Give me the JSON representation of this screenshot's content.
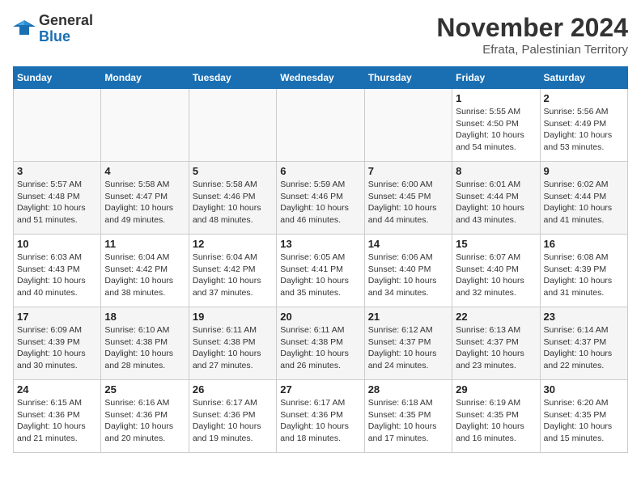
{
  "logo": {
    "text_general": "General",
    "text_blue": "Blue"
  },
  "header": {
    "month": "November 2024",
    "location": "Efrata, Palestinian Territory"
  },
  "weekdays": [
    "Sunday",
    "Monday",
    "Tuesday",
    "Wednesday",
    "Thursday",
    "Friday",
    "Saturday"
  ],
  "weeks": [
    [
      {
        "day": "",
        "info": ""
      },
      {
        "day": "",
        "info": ""
      },
      {
        "day": "",
        "info": ""
      },
      {
        "day": "",
        "info": ""
      },
      {
        "day": "",
        "info": ""
      },
      {
        "day": "1",
        "sunrise": "Sunrise: 5:55 AM",
        "sunset": "Sunset: 4:50 PM",
        "daylight": "Daylight: 10 hours and 54 minutes."
      },
      {
        "day": "2",
        "sunrise": "Sunrise: 5:56 AM",
        "sunset": "Sunset: 4:49 PM",
        "daylight": "Daylight: 10 hours and 53 minutes."
      }
    ],
    [
      {
        "day": "3",
        "sunrise": "Sunrise: 5:57 AM",
        "sunset": "Sunset: 4:48 PM",
        "daylight": "Daylight: 10 hours and 51 minutes."
      },
      {
        "day": "4",
        "sunrise": "Sunrise: 5:58 AM",
        "sunset": "Sunset: 4:47 PM",
        "daylight": "Daylight: 10 hours and 49 minutes."
      },
      {
        "day": "5",
        "sunrise": "Sunrise: 5:58 AM",
        "sunset": "Sunset: 4:46 PM",
        "daylight": "Daylight: 10 hours and 48 minutes."
      },
      {
        "day": "6",
        "sunrise": "Sunrise: 5:59 AM",
        "sunset": "Sunset: 4:46 PM",
        "daylight": "Daylight: 10 hours and 46 minutes."
      },
      {
        "day": "7",
        "sunrise": "Sunrise: 6:00 AM",
        "sunset": "Sunset: 4:45 PM",
        "daylight": "Daylight: 10 hours and 44 minutes."
      },
      {
        "day": "8",
        "sunrise": "Sunrise: 6:01 AM",
        "sunset": "Sunset: 4:44 PM",
        "daylight": "Daylight: 10 hours and 43 minutes."
      },
      {
        "day": "9",
        "sunrise": "Sunrise: 6:02 AM",
        "sunset": "Sunset: 4:44 PM",
        "daylight": "Daylight: 10 hours and 41 minutes."
      }
    ],
    [
      {
        "day": "10",
        "sunrise": "Sunrise: 6:03 AM",
        "sunset": "Sunset: 4:43 PM",
        "daylight": "Daylight: 10 hours and 40 minutes."
      },
      {
        "day": "11",
        "sunrise": "Sunrise: 6:04 AM",
        "sunset": "Sunset: 4:42 PM",
        "daylight": "Daylight: 10 hours and 38 minutes."
      },
      {
        "day": "12",
        "sunrise": "Sunrise: 6:04 AM",
        "sunset": "Sunset: 4:42 PM",
        "daylight": "Daylight: 10 hours and 37 minutes."
      },
      {
        "day": "13",
        "sunrise": "Sunrise: 6:05 AM",
        "sunset": "Sunset: 4:41 PM",
        "daylight": "Daylight: 10 hours and 35 minutes."
      },
      {
        "day": "14",
        "sunrise": "Sunrise: 6:06 AM",
        "sunset": "Sunset: 4:40 PM",
        "daylight": "Daylight: 10 hours and 34 minutes."
      },
      {
        "day": "15",
        "sunrise": "Sunrise: 6:07 AM",
        "sunset": "Sunset: 4:40 PM",
        "daylight": "Daylight: 10 hours and 32 minutes."
      },
      {
        "day": "16",
        "sunrise": "Sunrise: 6:08 AM",
        "sunset": "Sunset: 4:39 PM",
        "daylight": "Daylight: 10 hours and 31 minutes."
      }
    ],
    [
      {
        "day": "17",
        "sunrise": "Sunrise: 6:09 AM",
        "sunset": "Sunset: 4:39 PM",
        "daylight": "Daylight: 10 hours and 30 minutes."
      },
      {
        "day": "18",
        "sunrise": "Sunrise: 6:10 AM",
        "sunset": "Sunset: 4:38 PM",
        "daylight": "Daylight: 10 hours and 28 minutes."
      },
      {
        "day": "19",
        "sunrise": "Sunrise: 6:11 AM",
        "sunset": "Sunset: 4:38 PM",
        "daylight": "Daylight: 10 hours and 27 minutes."
      },
      {
        "day": "20",
        "sunrise": "Sunrise: 6:11 AM",
        "sunset": "Sunset: 4:38 PM",
        "daylight": "Daylight: 10 hours and 26 minutes."
      },
      {
        "day": "21",
        "sunrise": "Sunrise: 6:12 AM",
        "sunset": "Sunset: 4:37 PM",
        "daylight": "Daylight: 10 hours and 24 minutes."
      },
      {
        "day": "22",
        "sunrise": "Sunrise: 6:13 AM",
        "sunset": "Sunset: 4:37 PM",
        "daylight": "Daylight: 10 hours and 23 minutes."
      },
      {
        "day": "23",
        "sunrise": "Sunrise: 6:14 AM",
        "sunset": "Sunset: 4:37 PM",
        "daylight": "Daylight: 10 hours and 22 minutes."
      }
    ],
    [
      {
        "day": "24",
        "sunrise": "Sunrise: 6:15 AM",
        "sunset": "Sunset: 4:36 PM",
        "daylight": "Daylight: 10 hours and 21 minutes."
      },
      {
        "day": "25",
        "sunrise": "Sunrise: 6:16 AM",
        "sunset": "Sunset: 4:36 PM",
        "daylight": "Daylight: 10 hours and 20 minutes."
      },
      {
        "day": "26",
        "sunrise": "Sunrise: 6:17 AM",
        "sunset": "Sunset: 4:36 PM",
        "daylight": "Daylight: 10 hours and 19 minutes."
      },
      {
        "day": "27",
        "sunrise": "Sunrise: 6:17 AM",
        "sunset": "Sunset: 4:36 PM",
        "daylight": "Daylight: 10 hours and 18 minutes."
      },
      {
        "day": "28",
        "sunrise": "Sunrise: 6:18 AM",
        "sunset": "Sunset: 4:35 PM",
        "daylight": "Daylight: 10 hours and 17 minutes."
      },
      {
        "day": "29",
        "sunrise": "Sunrise: 6:19 AM",
        "sunset": "Sunset: 4:35 PM",
        "daylight": "Daylight: 10 hours and 16 minutes."
      },
      {
        "day": "30",
        "sunrise": "Sunrise: 6:20 AM",
        "sunset": "Sunset: 4:35 PM",
        "daylight": "Daylight: 10 hours and 15 minutes."
      }
    ]
  ]
}
